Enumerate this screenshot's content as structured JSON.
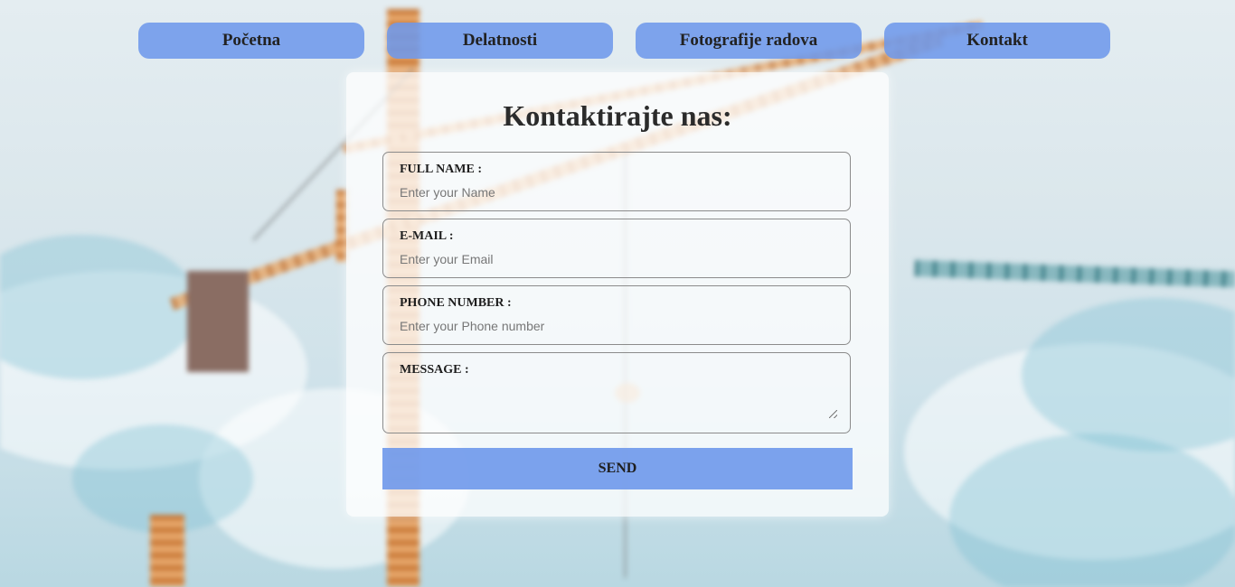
{
  "nav": {
    "items": [
      {
        "label": "Početna"
      },
      {
        "label": "Delatnosti"
      },
      {
        "label": "Fotografije radova"
      },
      {
        "label": "Kontakt"
      }
    ]
  },
  "form": {
    "title": "Kontaktirajte nas:",
    "fields": [
      {
        "label": "FULL NAME :",
        "placeholder": "Enter your Name",
        "value": ""
      },
      {
        "label": "E-MAIL :",
        "placeholder": "Enter your Email",
        "value": ""
      },
      {
        "label": "PHONE NUMBER :",
        "placeholder": "Enter your Phone number",
        "value": ""
      },
      {
        "label": "MESSAGE :",
        "placeholder": "",
        "value": ""
      }
    ],
    "submit_label": "SEND"
  },
  "colors": {
    "nav_button": "#6e98eb",
    "send_button": "#6e98eb",
    "card": "#ffffff"
  }
}
